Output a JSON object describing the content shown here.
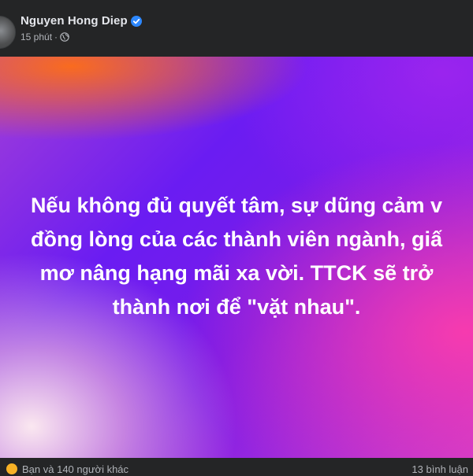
{
  "post": {
    "author": "Nguyen Hong Diep",
    "timestamp": "15 phút",
    "separator": "·",
    "privacy_icon": "globe-icon",
    "verified_icon": "verified-badge-icon",
    "text_lines": [
      "Nếu không đủ quyết tâm, sự dũng cảm v",
      "đồng lòng của các thành viên ngành, giấ",
      "mơ nâng hạng mãi xa vời. TTCK sẽ trở",
      "thành nơi để \"vặt nhau\"."
    ]
  },
  "footer": {
    "reaction_icon": "haha-reaction-icon",
    "reactions_text": "Bạn và 140 người khác",
    "comments_text": "13 bình luận"
  },
  "colors": {
    "page_bg": "#242526",
    "text_primary": "#e4e6eb",
    "text_secondary": "#b0b3b8",
    "verified_blue": "#2d88ff",
    "post_gradient": [
      "#ff6e14",
      "#6a1cf2",
      "#ff3caa",
      "#ffeef0"
    ]
  }
}
